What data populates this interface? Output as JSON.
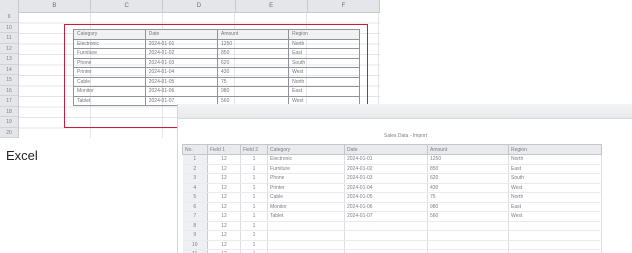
{
  "excel": {
    "caption": "Excel",
    "column_letters": [
      "B",
      "C",
      "D",
      "E",
      "F"
    ],
    "row_numbers": [
      "9",
      "10",
      "11",
      "12",
      "13",
      "14",
      "15",
      "16",
      "17",
      "18",
      "19",
      "20"
    ],
    "table_rows": [
      [
        "Category",
        "Date",
        "Amount",
        "Region"
      ],
      [
        "Electronic",
        "2024-01-01",
        "1250",
        "North"
      ],
      [
        "Furniture",
        "2024-01-02",
        "850",
        "East"
      ],
      [
        "Phone",
        "2024-01-03",
        "620",
        "South"
      ],
      [
        "Printer",
        "2024-01-04",
        "430",
        "West"
      ],
      [
        "Cable",
        "2024-01-05",
        "75",
        "North"
      ],
      [
        "Monitor",
        "2024-01-06",
        "980",
        "East"
      ],
      [
        "Tablet",
        "2024-01-07",
        "560",
        "West"
      ]
    ]
  },
  "database": {
    "title": "Sales Data - Import",
    "columns": [
      "No.",
      "Field 1",
      "Field 2",
      "Category",
      "Date",
      "Amount",
      "Region"
    ],
    "rows": [
      [
        "1",
        "12",
        "1",
        "Electronic",
        "2024-01-01",
        "1250",
        "North"
      ],
      [
        "2",
        "12",
        "1",
        "Furniture",
        "2024-01-02",
        "850",
        "East"
      ],
      [
        "3",
        "12",
        "1",
        "Phone",
        "2024-01-03",
        "620",
        "South"
      ],
      [
        "4",
        "12",
        "1",
        "Printer",
        "2024-01-04",
        "430",
        "West"
      ],
      [
        "5",
        "12",
        "1",
        "Cable",
        "2024-01-05",
        "75",
        "North"
      ],
      [
        "6",
        "12",
        "1",
        "Monitor",
        "2024-01-06",
        "980",
        "East"
      ],
      [
        "7",
        "12",
        "1",
        "Tablet",
        "2024-01-07",
        "560",
        "West"
      ],
      [
        "8",
        "12",
        "1",
        "",
        "",
        "",
        ""
      ],
      [
        "9",
        "12",
        "1",
        "",
        "",
        "",
        ""
      ],
      [
        "10",
        "12",
        "1",
        "",
        "",
        "",
        ""
      ],
      [
        "11",
        "12",
        "1",
        "",
        "",
        "",
        ""
      ]
    ]
  },
  "colors": {
    "highlight_frame": "#c61e3a"
  }
}
